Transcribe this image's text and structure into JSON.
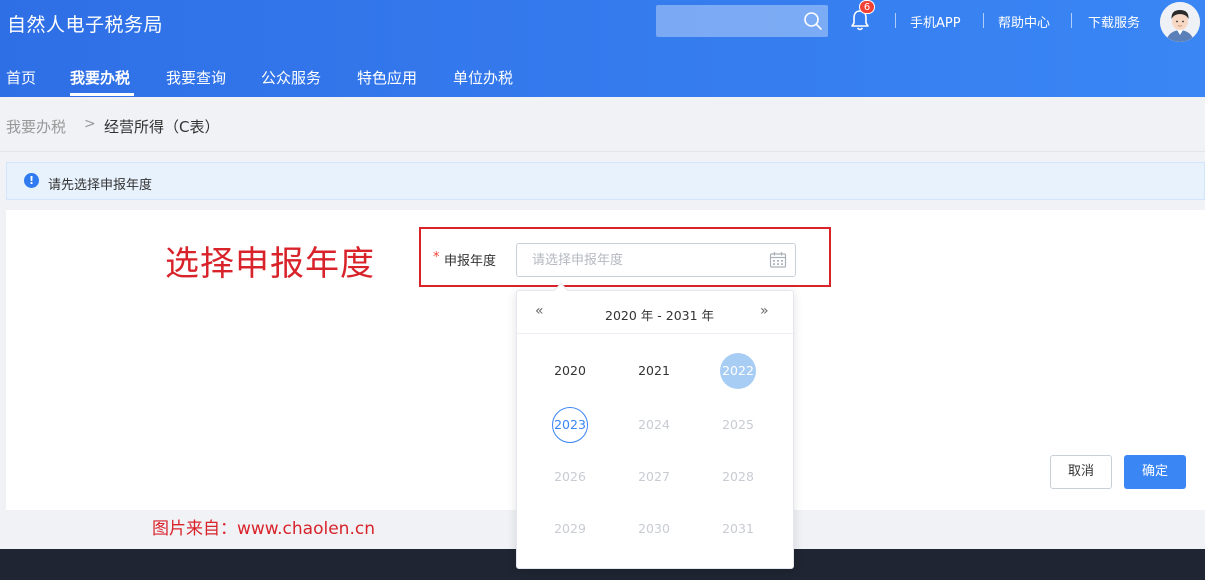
{
  "header": {
    "app_title": "自然人电子税务局",
    "search_placeholder": "",
    "notification_count": "6",
    "links": [
      "手机APP",
      "帮助中心",
      "下载服务"
    ]
  },
  "nav": {
    "items": [
      "首页",
      "我要办税",
      "我要查询",
      "公众服务",
      "特色应用",
      "单位办税"
    ],
    "active": "我要办税"
  },
  "breadcrumb": {
    "parent": "我要办税",
    "separator": ">",
    "current": "经营所得（C表）"
  },
  "notice": {
    "icon": "!",
    "text": "请先选择申报年度"
  },
  "form": {
    "annotation": "选择申报年度",
    "required_mark": "*",
    "label": "申报年度",
    "placeholder": "请选择申报年度"
  },
  "picker": {
    "prev": "«",
    "next": "»",
    "range_label": "2020 年 - 2031 年",
    "years": [
      {
        "label": "2020",
        "state": "normal"
      },
      {
        "label": "2021",
        "state": "normal"
      },
      {
        "label": "2022",
        "state": "selected"
      },
      {
        "label": "2023",
        "state": "today"
      },
      {
        "label": "2024",
        "state": "disabled"
      },
      {
        "label": "2025",
        "state": "disabled"
      },
      {
        "label": "2026",
        "state": "disabled"
      },
      {
        "label": "2027",
        "state": "disabled"
      },
      {
        "label": "2028",
        "state": "disabled"
      },
      {
        "label": "2029",
        "state": "disabled"
      },
      {
        "label": "2030",
        "state": "disabled"
      },
      {
        "label": "2031",
        "state": "disabled"
      }
    ]
  },
  "buttons": {
    "cancel": "取消",
    "confirm": "确定"
  },
  "watermark": {
    "text": "图片来自：www.chaolen.cn"
  },
  "colors": {
    "brand_blue": "#2f6fe6",
    "annotation_red": "#d9232b",
    "selected_year": "#a8cdf5"
  }
}
